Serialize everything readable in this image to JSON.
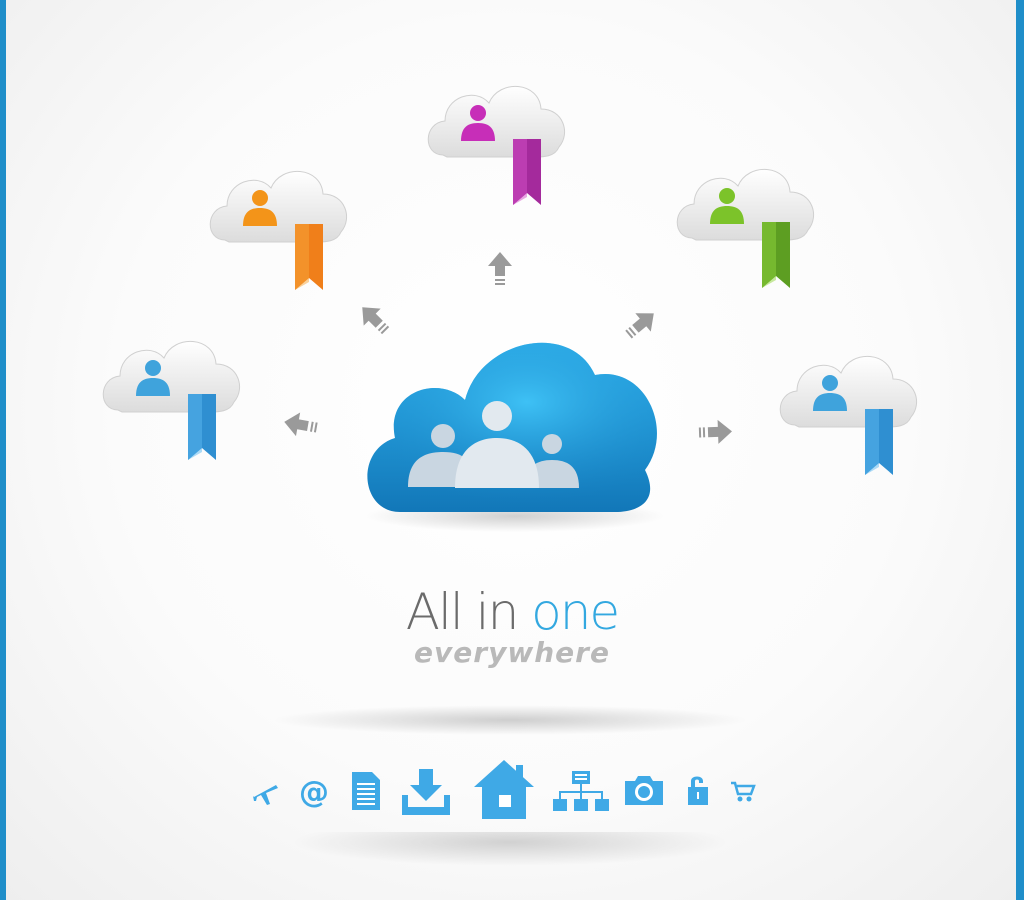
{
  "headline": {
    "word1": "All in ",
    "word2": "one",
    "subtitle": "everywhere"
  },
  "colors": {
    "frame": "#1f8ec9",
    "main_cloud": "#1b8fd0",
    "accent_blue": "#33a8e0",
    "headline_gray": "#6b6b6b",
    "subtitle_gray": "#b9b9b9",
    "icon_blue": "#3fa9e6"
  },
  "clouds": [
    {
      "name": "cloud-orange",
      "user_color": "#f39419",
      "ribbon_color": "#f07f1a"
    },
    {
      "name": "cloud-magenta",
      "user_color": "#c72eb8",
      "ribbon_color": "#a42a9c"
    },
    {
      "name": "cloud-green",
      "user_color": "#7cc32a",
      "ribbon_color": "#5d9e22"
    },
    {
      "name": "cloud-blue-left",
      "user_color": "#3fa3dc",
      "ribbon_color": "#2f8fd1"
    },
    {
      "name": "cloud-blue-right",
      "user_color": "#3fa3dc",
      "ribbon_color": "#2f8fd1"
    }
  ],
  "icon_bar": [
    "airplane-icon",
    "at-sign-icon",
    "document-icon",
    "download-icon",
    "home-icon",
    "sitemap-icon",
    "camera-icon",
    "unlock-icon",
    "shopping-cart-icon"
  ]
}
